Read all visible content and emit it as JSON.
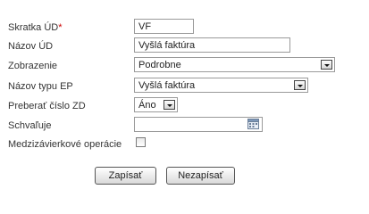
{
  "form": {
    "fields": [
      {
        "label": "Skratka ÚD",
        "required_mark": "*",
        "value": "VF"
      },
      {
        "label": "Názov ÚD",
        "value": "Vyšlá faktúra"
      },
      {
        "label": "Zobrazenie",
        "value": "Podrobne"
      },
      {
        "label": "Názov typu EP",
        "value": "Vyšlá faktúra"
      },
      {
        "label": "Preberať číslo ZD",
        "value": "Áno"
      },
      {
        "label": "Schvaľuje",
        "value": ""
      },
      {
        "label": "Medzizávierkové operácie",
        "checked": false
      }
    ]
  },
  "buttons": {
    "save_label": "Zapísať",
    "cancel_label": "Nezapísať"
  },
  "icons": {
    "dropdown": "chevron-down-icon",
    "calendar": "calendar-icon"
  }
}
